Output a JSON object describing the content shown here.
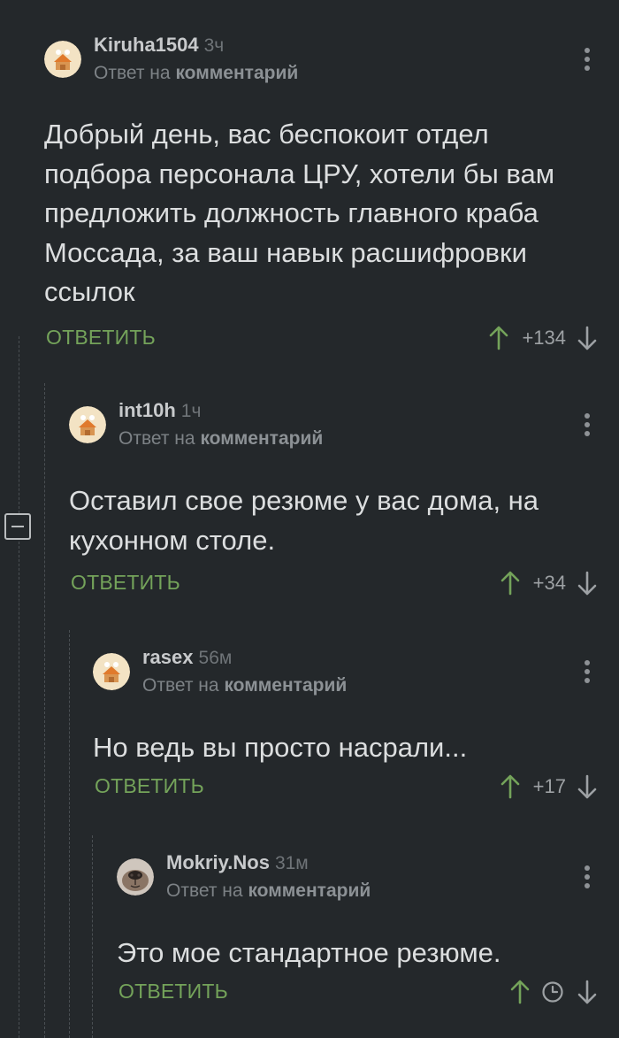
{
  "comments": [
    {
      "username": "Kiruha1504",
      "time": "3ч",
      "reply_prefix": "Ответ на",
      "reply_link": "комментарий",
      "text": "Добрый день, вас беспокоит отдел подбора персонала ЦРУ, хотели бы вам предложить должность главного краба Моссада, за ваш навык расшифровки ссылок",
      "reply_label": "ОТВЕТИТЬ",
      "rating": "+134",
      "avatar": "default-avatar-icon"
    },
    {
      "username": "int10h",
      "time": "1ч",
      "reply_prefix": "Ответ на",
      "reply_link": "комментарий",
      "text": "Оставил свое резюме у вас дома, на кухонном столе.",
      "reply_label": "ОТВЕТИТЬ",
      "rating": "+34",
      "avatar": "default-avatar-icon"
    },
    {
      "username": "rasex",
      "time": "56м",
      "reply_prefix": "Ответ на",
      "reply_link": "комментарий",
      "text": "Но ведь вы просто насрали...",
      "reply_label": "ОТВЕТИТЬ",
      "rating": "+17",
      "avatar": "default-avatar-icon"
    },
    {
      "username": "Mokriy.Nos",
      "time": "31м",
      "reply_prefix": "Ответ на",
      "reply_link": "комментарий",
      "text": "Это мое стандартное резюме.",
      "reply_label": "ОТВЕТИТЬ",
      "rating_icon": "clock-icon",
      "avatar": "dog-photo-avatar"
    }
  ],
  "colors": {
    "background": "#24282b",
    "accent_green": "#74a35a",
    "text": "#dcdedf",
    "muted": "#7d8286"
  }
}
